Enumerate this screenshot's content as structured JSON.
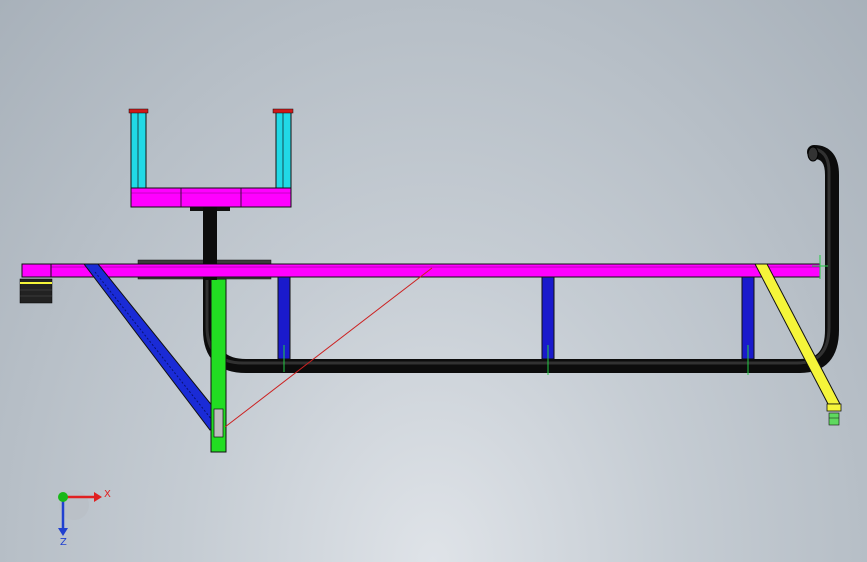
{
  "colors": {
    "frame_beam": "#ff00ff",
    "support_posts": "#1a1acc",
    "diagonal_brace_left": "#1a2bd6",
    "diagonal_brace_right": "#f5f53a",
    "vertical_post": "#22dd22",
    "seat_uprights": "#21d9e6",
    "pipe": "#0c0c0c",
    "end_block": "#222222",
    "guide_line": "#cc2020",
    "axis_x": "#e02020",
    "axis_y": "#18b818",
    "axis_z": "#2040d0"
  },
  "triad": {
    "x_label": "X",
    "z_label": "Z"
  }
}
